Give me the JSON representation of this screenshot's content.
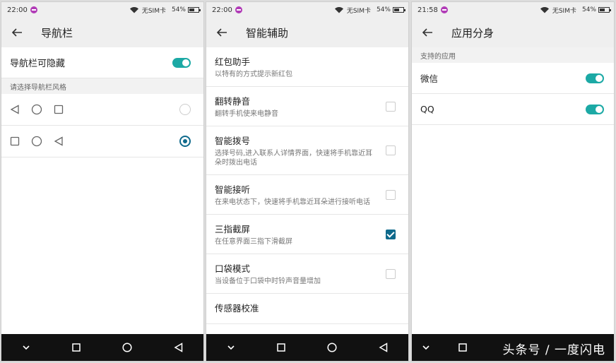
{
  "screens": [
    {
      "status": {
        "time": "22:00",
        "sim": "无SIM卡",
        "battery": "54%"
      },
      "title": "导航栏",
      "toggle_label": "导航栏可隐藏",
      "section_label": "请选择导航栏风格",
      "options": [
        {
          "icons": [
            "back-triangle-icon",
            "home-circle-icon",
            "recents-square-icon"
          ],
          "selected": false
        },
        {
          "icons": [
            "recents-square-icon",
            "home-circle-icon",
            "back-triangle-icon"
          ],
          "selected": true
        }
      ]
    },
    {
      "status": {
        "time": "22:00",
        "sim": "无SIM卡",
        "battery": "54%"
      },
      "title": "智能辅助",
      "items": [
        {
          "title": "红包助手",
          "desc": "以特有的方式提示新红包",
          "checkbox": null
        },
        {
          "title": "翻转静音",
          "desc": "翻转手机使来电静音",
          "checkbox": false
        },
        {
          "title": "智能拨号",
          "desc": "选择号码,进入联系人详情界面，快速将手机靠近耳朵时拨出电话",
          "checkbox": false
        },
        {
          "title": "智能接听",
          "desc": "在来电状态下，快速将手机靠近耳朵进行接听电话",
          "checkbox": false
        },
        {
          "title": "三指截屏",
          "desc": "在任意界面三指下滑截屏",
          "checkbox": true
        },
        {
          "title": "口袋模式",
          "desc": "当设备位于口袋中时铃声音量增加",
          "checkbox": false
        },
        {
          "title": "传感器校准",
          "desc": "",
          "checkbox": null
        }
      ]
    },
    {
      "status": {
        "time": "21:58",
        "sim": "无SIM卡",
        "battery": "54%"
      },
      "title": "应用分身",
      "section_label": "支持的应用",
      "apps": [
        {
          "name": "微信",
          "enabled": true
        },
        {
          "name": "QQ",
          "enabled": true
        }
      ]
    }
  ],
  "watermark": "头条号 / 一度闪电",
  "colors": {
    "accent": "#1ca9a5",
    "checked": "#0f6a8c",
    "navbar": "#111111",
    "appbar": "#efefef"
  }
}
